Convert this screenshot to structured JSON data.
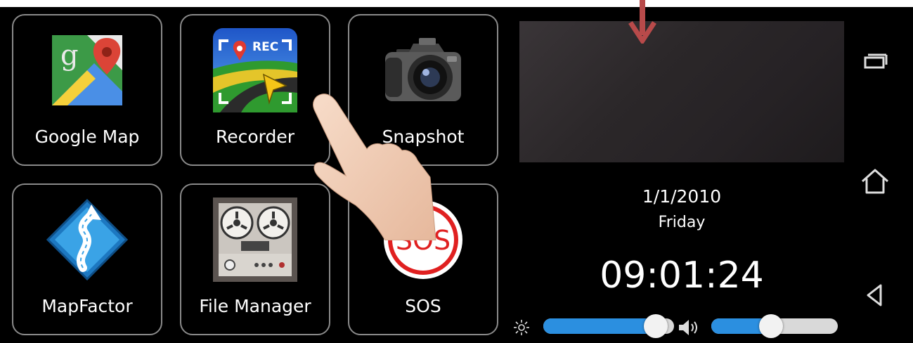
{
  "apps": [
    {
      "id": "google-map",
      "label": "Google Map",
      "icon": "google-maps-icon"
    },
    {
      "id": "recorder",
      "label": "Recorder",
      "icon": "recorder-icon",
      "badge": "REC"
    },
    {
      "id": "snapshot",
      "label": "Snapshot",
      "icon": "camera-icon"
    },
    {
      "id": "mapfactor",
      "label": "MapFactor",
      "icon": "mapfactor-icon"
    },
    {
      "id": "file-manager",
      "label": "File Manager",
      "icon": "reel-tape-icon"
    },
    {
      "id": "sos",
      "label": "SOS",
      "icon": "sos-icon",
      "badge": "SOS"
    }
  ],
  "status": {
    "date": "1/1/2010",
    "weekday": "Friday",
    "time": "09:01:24"
  },
  "sliders": {
    "brightness": {
      "icon": "brightness-icon",
      "value": 0.86
    },
    "volume": {
      "icon": "volume-icon",
      "value": 0.47
    }
  },
  "nav": {
    "recent": "recent-apps-icon",
    "home": "home-icon",
    "back": "back-icon"
  },
  "colors": {
    "accent": "#2b8fe0",
    "tile_border": "#8a8a8a",
    "annotation_arrow": "#b84a4a"
  }
}
